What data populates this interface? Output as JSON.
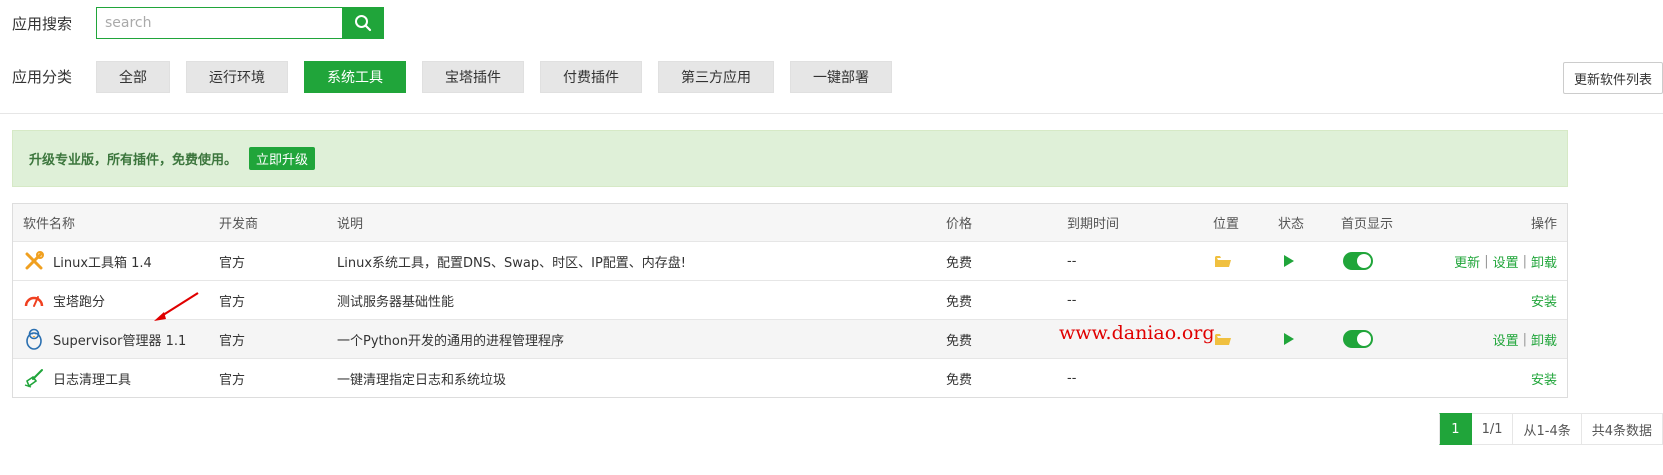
{
  "search": {
    "label": "应用搜索",
    "placeholder": "search",
    "value": ""
  },
  "category": {
    "label": "应用分类",
    "items": [
      "全部",
      "运行环境",
      "系统工具",
      "宝塔插件",
      "付费插件",
      "第三方应用",
      "一键部署"
    ],
    "active_index": 2
  },
  "refresh_label": "更新软件列表",
  "promo": {
    "text": "升级专业版，所有插件，免费使用。",
    "button": "立即升级"
  },
  "table": {
    "headers": [
      "软件名称",
      "开发商",
      "说明",
      "价格",
      "到期时间",
      "位置",
      "状态",
      "首页显示",
      "操作"
    ],
    "rows": [
      {
        "name": "Linux工具箱 1.4",
        "icon": "wrench-screwdriver-icon",
        "dev": "官方",
        "desc": "Linux系统工具，配置DNS、Swap、时区、IP配置、内存盘!",
        "price": "免费",
        "expire": "--",
        "ops": [
          "更新",
          "设置",
          "卸载"
        ],
        "installed": true,
        "home_enabled": true
      },
      {
        "name": "宝塔跑分",
        "icon": "speedometer-icon",
        "dev": "官方",
        "desc": "测试服务器基础性能",
        "price": "免费",
        "expire": "--",
        "ops": [
          "安装"
        ],
        "installed": false
      },
      {
        "name": "Supervisor管理器 1.1",
        "icon": "penguin-icon",
        "dev": "官方",
        "desc": "一个Python开发的通用的进程管理程序",
        "price": "免费",
        "expire": "",
        "ops": [
          "设置",
          "卸载"
        ],
        "installed": true,
        "home_enabled": true
      },
      {
        "name": "日志清理工具",
        "icon": "broom-icon",
        "dev": "官方",
        "desc": "一键清理指定日志和系统垃圾",
        "price": "免费",
        "expire": "--",
        "ops": [
          "安装"
        ],
        "installed": false
      }
    ]
  },
  "watermark": "www.daniao.org",
  "pagination": {
    "current": "1",
    "pages": "1/1",
    "range": "从1-4条",
    "total": "共4条数据"
  },
  "colors": {
    "accent": "#20a53a",
    "watermark": "#e00000",
    "promo_bg": "#dff0d8"
  }
}
